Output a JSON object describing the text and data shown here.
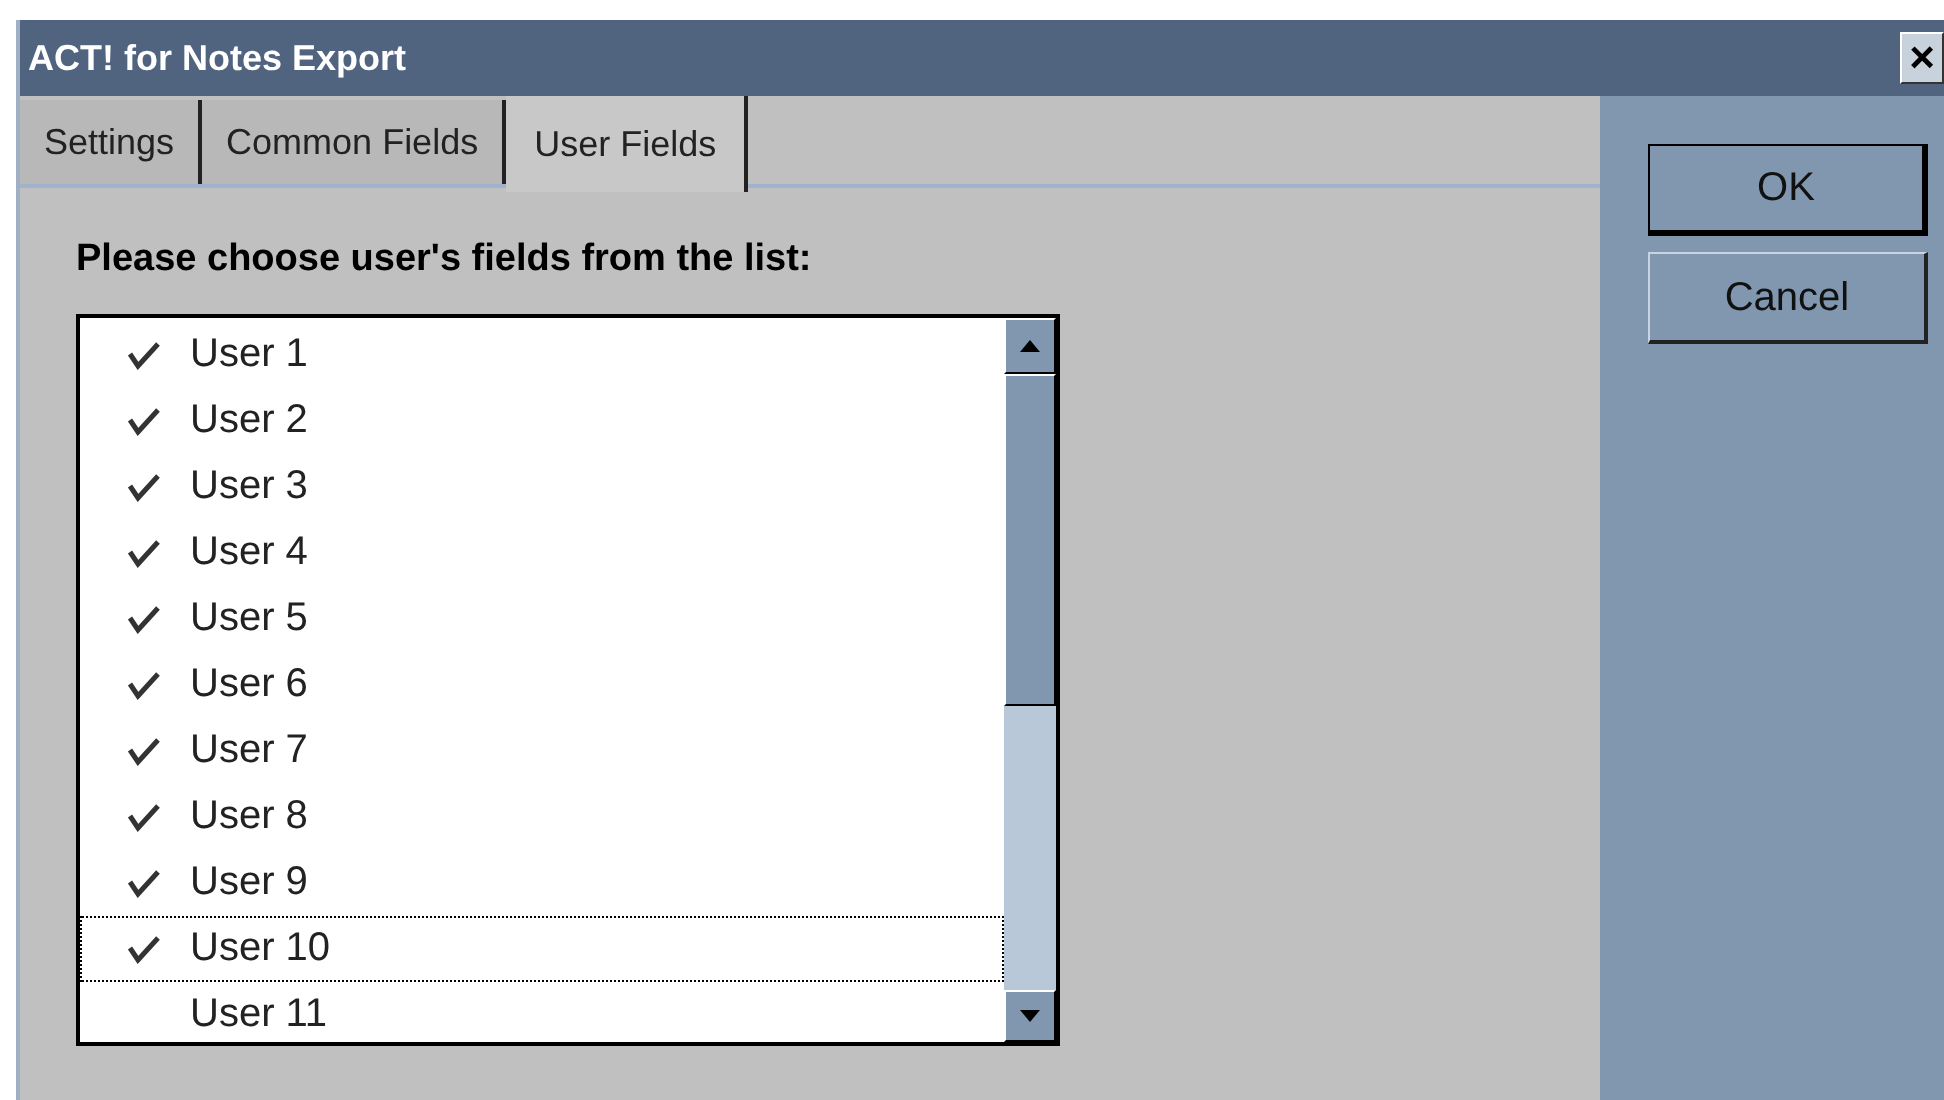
{
  "window": {
    "title": "ACT! for Notes Export",
    "close": "×"
  },
  "tabs": [
    {
      "label": "Settings",
      "selected": false
    },
    {
      "label": "Common Fields",
      "selected": false
    },
    {
      "label": "User Fields",
      "selected": true
    }
  ],
  "heading": "Please choose user's fields from the list:",
  "items": [
    {
      "label": "User 1",
      "checked": true,
      "selected": false
    },
    {
      "label": "User 2",
      "checked": true,
      "selected": false
    },
    {
      "label": "User 3",
      "checked": true,
      "selected": false
    },
    {
      "label": "User 4",
      "checked": true,
      "selected": false
    },
    {
      "label": "User 5",
      "checked": true,
      "selected": false
    },
    {
      "label": "User 6",
      "checked": true,
      "selected": false
    },
    {
      "label": "User 7",
      "checked": true,
      "selected": false
    },
    {
      "label": "User 8",
      "checked": true,
      "selected": false
    },
    {
      "label": "User 9",
      "checked": true,
      "selected": false
    },
    {
      "label": "User 10",
      "checked": true,
      "selected": true
    },
    {
      "label": "User 11",
      "checked": false,
      "selected": false
    }
  ],
  "buttons": [
    {
      "label": "OK",
      "default": true
    },
    {
      "label": "Cancel",
      "default": false
    }
  ]
}
